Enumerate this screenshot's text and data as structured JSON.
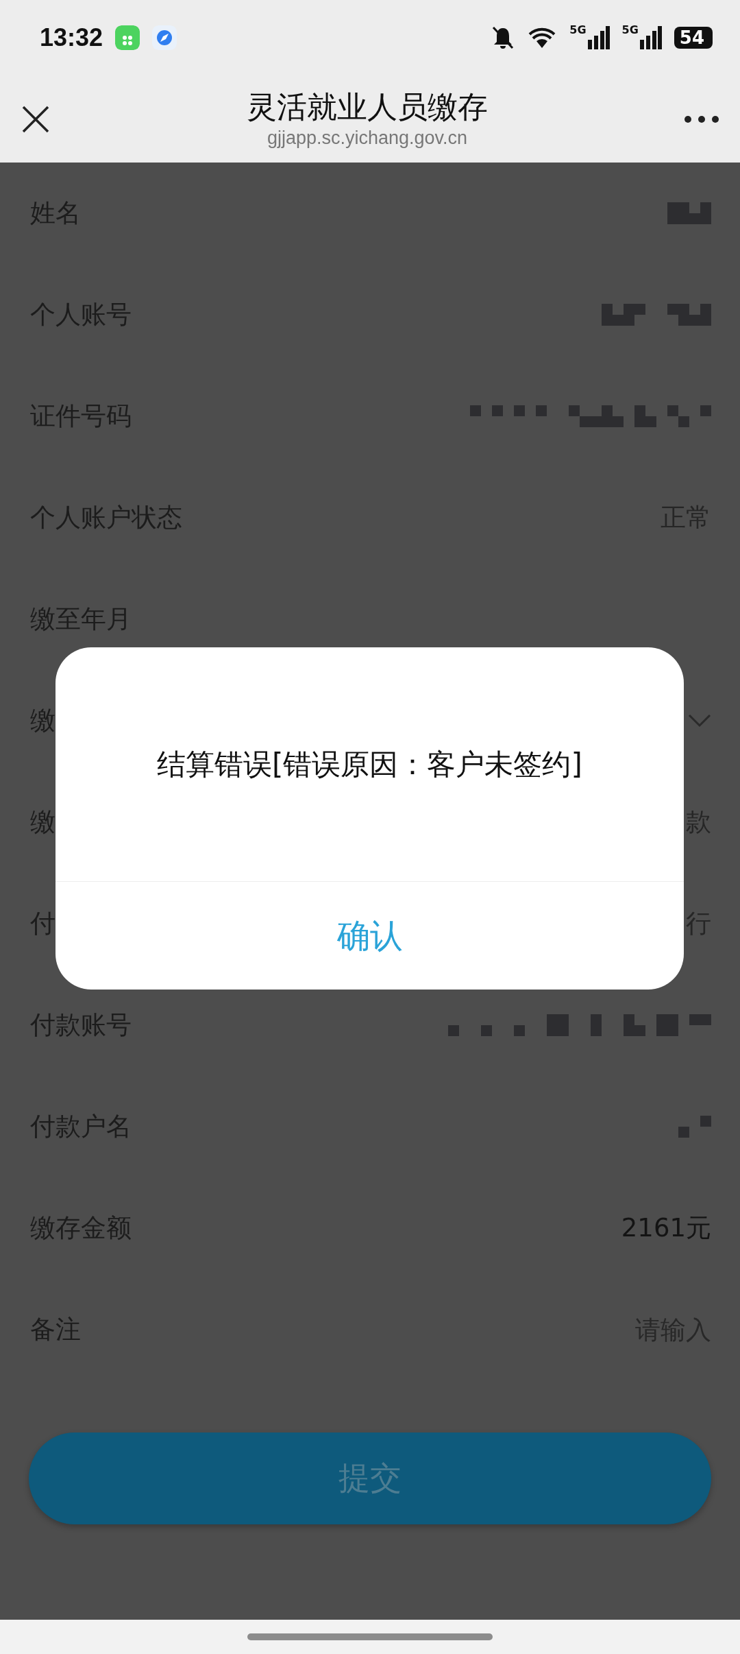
{
  "status_bar": {
    "time": "13:32",
    "networks": [
      "5G",
      "5G"
    ],
    "battery": "54"
  },
  "header": {
    "title": "灵活就业人员缴存",
    "url": "gjjapp.sc.yichang.gov.cn"
  },
  "form": {
    "rows": [
      {
        "label": "姓名",
        "kind": "masked"
      },
      {
        "label": "个人账号",
        "kind": "masked"
      },
      {
        "label": "证件号码",
        "kind": "masked"
      },
      {
        "label": "个人账户状态",
        "kind": "text",
        "value": "正常"
      },
      {
        "label": "缴至年月",
        "kind": "empty"
      },
      {
        "label": "缴",
        "kind": "select"
      },
      {
        "label": "缴",
        "kind": "text",
        "value": "款"
      },
      {
        "label": "付",
        "kind": "text",
        "value": "行"
      },
      {
        "label": "付款账号",
        "kind": "masked"
      },
      {
        "label": "付款户名",
        "kind": "masked"
      },
      {
        "label": "缴存金额",
        "kind": "input",
        "value": "2161元"
      },
      {
        "label": "备注",
        "kind": "input",
        "placeholder": "请输入"
      }
    ]
  },
  "submit_button": {
    "label": "提交"
  },
  "dialog": {
    "message": "结算错误[错误原因：客户未签约]",
    "button": "确认"
  }
}
